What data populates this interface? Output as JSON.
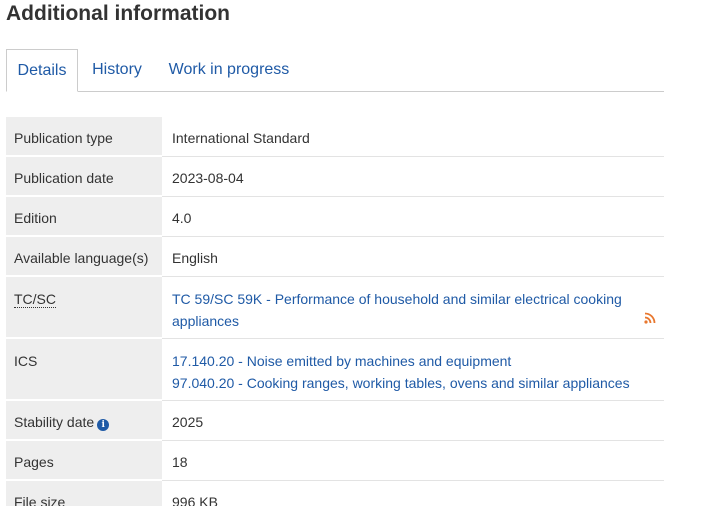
{
  "section": {
    "title": "Additional information"
  },
  "tabs": [
    {
      "label": "Details",
      "active": true
    },
    {
      "label": "History",
      "active": false
    },
    {
      "label": "Work in progress",
      "active": false
    }
  ],
  "details": {
    "publication_type": {
      "label": "Publication type",
      "value": "International Standard"
    },
    "publication_date": {
      "label": "Publication date",
      "value": "2023-08-04"
    },
    "edition": {
      "label": "Edition",
      "value": "4.0"
    },
    "languages": {
      "label": "Available language(s)",
      "value": "English"
    },
    "tc_sc": {
      "label": "TC/SC",
      "value": "TC 59/SC 59K - Performance of household and similar electrical cooking appliances",
      "icon": "rss-feed-icon"
    },
    "ics": {
      "label": "ICS",
      "items": [
        "17.140.20 - Noise emitted by machines and equipment",
        "97.040.20 - Cooking ranges, working tables, ovens and similar appliances"
      ]
    },
    "stability_date": {
      "label": "Stability date",
      "value": "2025",
      "icon": "info-icon"
    },
    "pages": {
      "label": "Pages",
      "value": "18"
    },
    "file_size": {
      "label": "File size",
      "value_number": "996",
      "value_unit": "KB"
    }
  },
  "colors": {
    "link": "#1f5aa6",
    "label_bg": "#eeeeee",
    "rss": "#e8772e"
  }
}
